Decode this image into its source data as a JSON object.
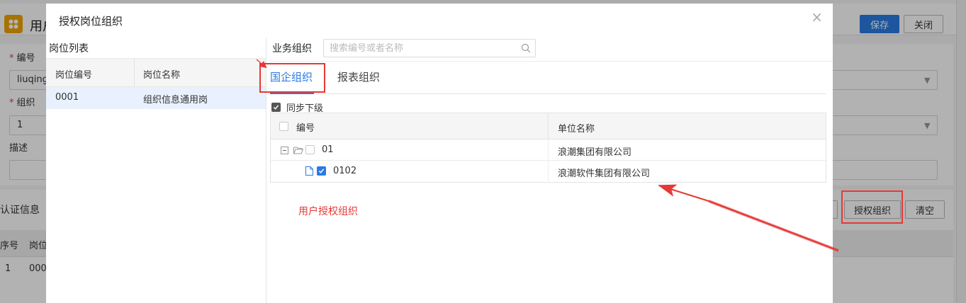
{
  "background": {
    "app_title": "用户",
    "save_label": "保存",
    "close_label": "关闭",
    "code_label": "编号",
    "code_value": "liuqing",
    "org_label": "组织",
    "org_value": "1",
    "desc_label": "描述",
    "section_title": "认证信息",
    "auth_org_button": "授权组织",
    "clear_button": "清空",
    "grid_col_seq": "序号",
    "grid_col_post": "岗位",
    "grid_row_seq": "1",
    "grid_row_post": "000"
  },
  "dialog": {
    "title": "授权岗位组织",
    "close_glyph": "×",
    "left_title": "岗位列表",
    "left_columns": [
      "岗位编号",
      "岗位名称"
    ],
    "left_rows": [
      {
        "code": "0001",
        "name": "组织信息通用岗"
      }
    ],
    "biz_label": "业务组织",
    "search_placeholder": "搜索编号或者名称",
    "tabs": [
      {
        "label": "国企组织",
        "active": true
      },
      {
        "label": "报表组织",
        "active": false
      }
    ],
    "sync_label": "同步下级",
    "sync_checked": true,
    "tree_columns": [
      "编号",
      "单位名称"
    ],
    "tree_rows": [
      {
        "code": "01",
        "name": "浪潮集团有限公司",
        "checked": false,
        "expanded": true
      },
      {
        "code": "0102",
        "name": "浪潮软件集团有限公司",
        "checked": true
      }
    ]
  },
  "annotation": {
    "text": "用户授权组织",
    "color": "#e53935"
  },
  "colors": {
    "accent": "#2a7be4",
    "annotation_red": "#e53935",
    "app_icon": "#f0a500"
  }
}
